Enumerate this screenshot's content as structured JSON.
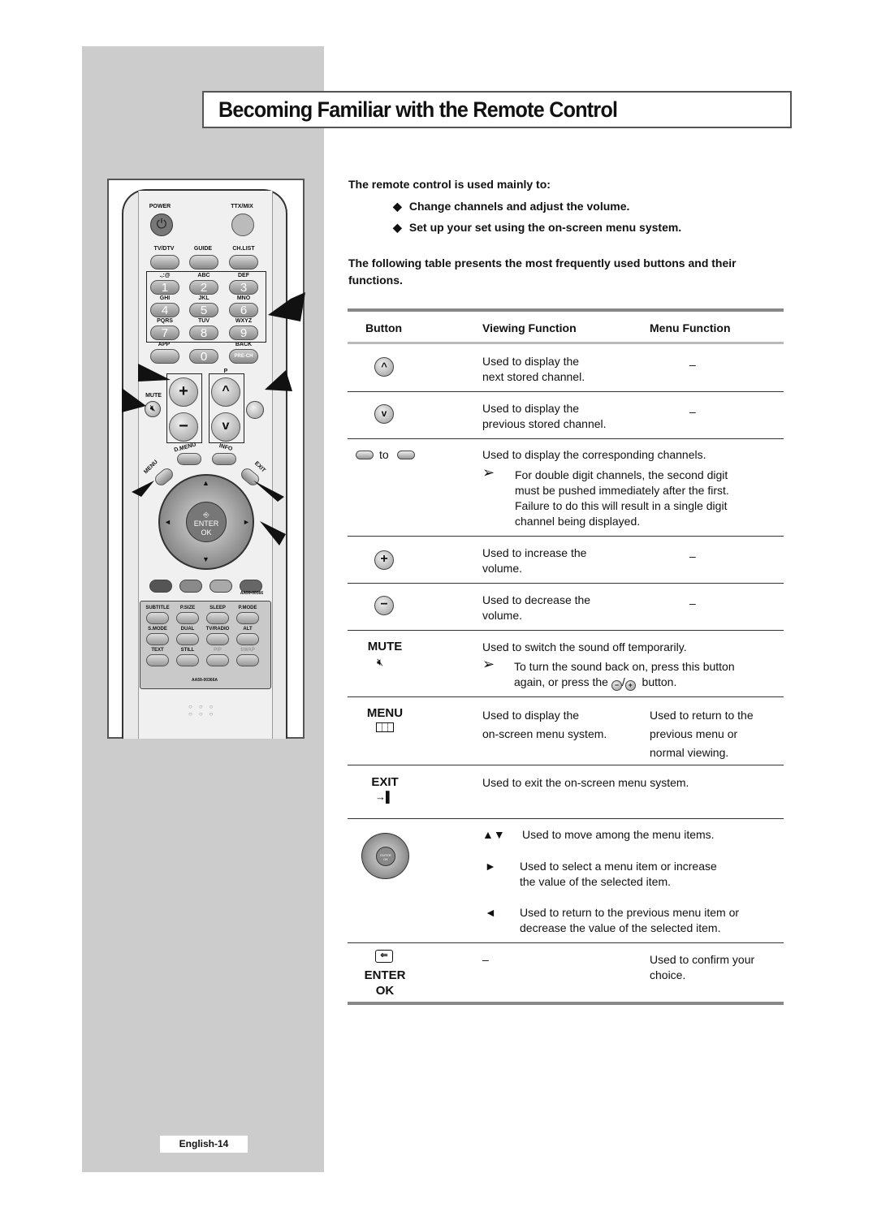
{
  "page": {
    "title": "Becoming Familiar with the Remote Control",
    "page_number": "English-14"
  },
  "remote": {
    "top_labels": {
      "power": "POWER",
      "ttx": "TTX/MIX",
      "tvdtv": "TV/DTV",
      "guide": "GUIDE",
      "chlist": "CH.LIST"
    },
    "keypad": [
      {
        "letters": ".,:@",
        "digit": "1"
      },
      {
        "letters": "ABC",
        "digit": "2"
      },
      {
        "letters": "DEF",
        "digit": "3"
      },
      {
        "letters": "GHI",
        "digit": "4"
      },
      {
        "letters": "JKL",
        "digit": "5"
      },
      {
        "letters": "MNO",
        "digit": "6"
      },
      {
        "letters": "PQRS",
        "digit": "7"
      },
      {
        "letters": "TUV",
        "digit": "8"
      },
      {
        "letters": "WXYZ",
        "digit": "9"
      }
    ],
    "app": "APP",
    "zero": "0",
    "back": "BACK",
    "prech": "PRE-CH",
    "mute": "MUTE",
    "p": "P",
    "dmenu": "D.MENU",
    "info": "INFO",
    "menu": "MENU",
    "exit": "EXIT",
    "enter": "ENTER",
    "ok": "OK",
    "model_top": "AA59-00366",
    "model_bottom": "AA59-00366A",
    "color_buttons": [
      "#555555",
      "#8a8a8a",
      "#a9a9a9",
      "#666666"
    ],
    "lower_buttons": [
      "SUBTITLE",
      "P.SIZE",
      "SLEEP",
      "P.MODE",
      "S.MODE",
      "DUAL",
      "TV/RADIO",
      "ALT",
      "TEXT",
      "STILL",
      "PIP",
      "SWAP"
    ]
  },
  "intro": {
    "heading": "The remote control is used mainly to:",
    "bullets": [
      "Change channels and adjust the volume.",
      "Set up your set using the on-screen menu system."
    ],
    "paragraph": "The following table presents the most frequently used buttons and their functions."
  },
  "table": {
    "headers": [
      "Button",
      "Viewing Function",
      "Menu Function"
    ],
    "rows": [
      {
        "button": "channel-up",
        "viewing": [
          "Used to display the",
          "next stored channel."
        ],
        "menu": "–"
      },
      {
        "button": "channel-down",
        "viewing": [
          "Used to display the",
          "previous stored channel."
        ],
        "menu": "–"
      },
      {
        "button": "digits",
        "button_text": "to",
        "viewing": [
          "Used to display the corresponding channels."
        ],
        "note": [
          "For double digit channels, the second digit",
          "must be pushed immediately after the first.",
          "Failure to do this will result in a single digit",
          "channel being displayed."
        ],
        "menu": ""
      },
      {
        "button": "volume-up",
        "viewing": [
          "Used to increase the",
          "volume."
        ],
        "menu": "–"
      },
      {
        "button": "volume-down",
        "viewing": [
          "Used to decrease the",
          "volume."
        ],
        "menu": "–"
      },
      {
        "button": "MUTE",
        "viewing": [
          "Used to switch the sound off temporarily."
        ],
        "note": [
          "To turn the sound back on, press this button",
          "again, or press the",
          "button."
        ],
        "menu": ""
      },
      {
        "button": "MENU",
        "viewing": [
          "Used to display the",
          "on-screen menu system."
        ],
        "menu": [
          "Used to return to the",
          "previous menu or",
          "normal viewing."
        ]
      },
      {
        "button": "EXIT",
        "viewing": [
          "Used to exit the on-screen menu system."
        ],
        "menu": ""
      },
      {
        "button": "nav-pad",
        "items": [
          {
            "symbol": "▲▼",
            "text": [
              "Used to move among the menu items."
            ]
          },
          {
            "symbol": "►",
            "text": [
              "Used to select a menu item or increase",
              "the value of the selected item."
            ]
          },
          {
            "symbol": "◄",
            "text": [
              "Used to return to the previous menu item or",
              "decrease the value of the selected item."
            ]
          }
        ]
      },
      {
        "button": "ENTER",
        "button_sub": "OK",
        "viewing": [
          "–"
        ],
        "menu": [
          "Used to confirm your",
          "choice."
        ]
      }
    ]
  }
}
